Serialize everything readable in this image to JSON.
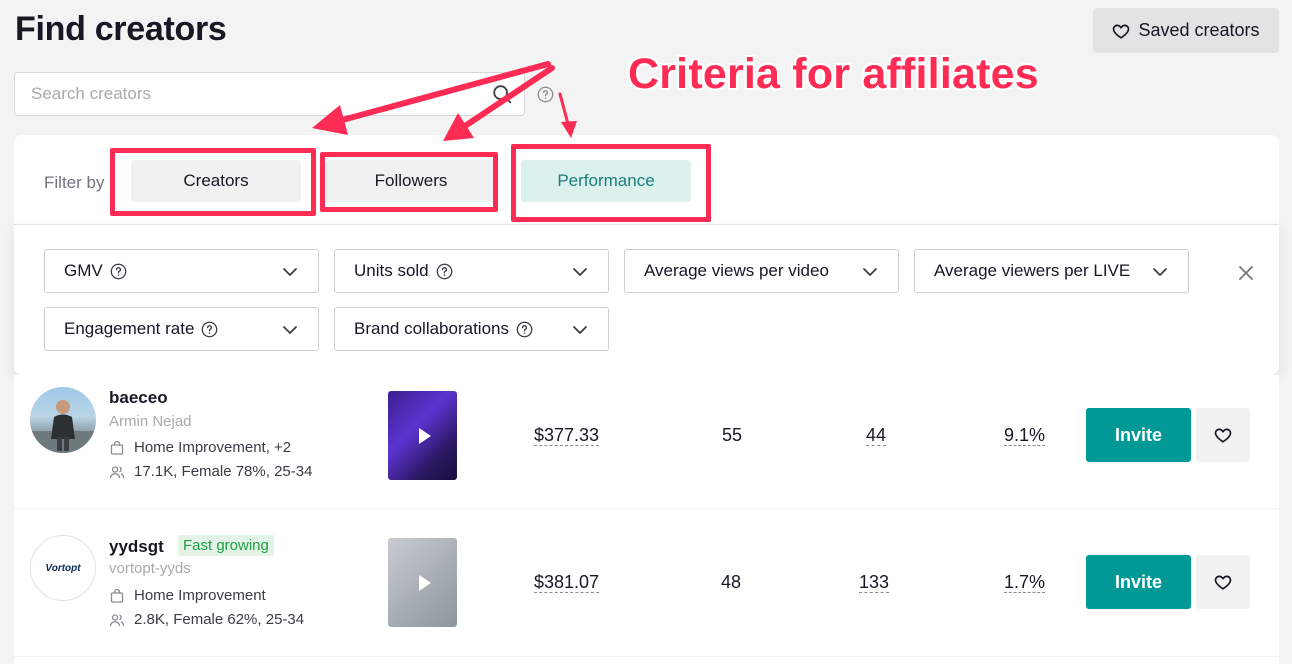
{
  "header": {
    "title": "Find creators",
    "saved_label": "Saved creators"
  },
  "search": {
    "placeholder": "Search creators"
  },
  "annotation": {
    "text": "Criteria for affiliates"
  },
  "filter": {
    "label": "Filter by",
    "tabs": [
      {
        "label": "Creators",
        "active": false
      },
      {
        "label": "Followers",
        "active": false
      },
      {
        "label": "Performance",
        "active": true
      }
    ]
  },
  "dropdowns": [
    {
      "label": "GMV",
      "has_help": true
    },
    {
      "label": "Units sold",
      "has_help": true
    },
    {
      "label": "Average views per video",
      "has_help": false
    },
    {
      "label": "Average viewers per LIVE",
      "has_help": false
    },
    {
      "label": "Engagement rate",
      "has_help": true
    },
    {
      "label": "Brand collaborations",
      "has_help": true
    }
  ],
  "creators": [
    {
      "handle": "baeceo",
      "name": "Armin Nejad",
      "badge": "",
      "category": "Home Improvement, +2",
      "audience": "17.1K, Female 78%, 25-34",
      "gmv": "$377.33",
      "units": "55",
      "views": "44",
      "engagement": "9.1%",
      "invite_label": "Invite"
    },
    {
      "handle": "yydsgt",
      "name": "vortopt-yyds",
      "badge": "Fast growing",
      "logo_text": "Vortopt",
      "category": "Home Improvement",
      "audience": "2.8K, Female 62%, 25-34",
      "gmv": "$381.07",
      "units": "48",
      "views": "133",
      "engagement": "1.7%",
      "invite_label": "Invite"
    }
  ],
  "colors": {
    "accent": "#009995",
    "annotation": "#fe2c55",
    "active_tab_bg": "#dcf0ee",
    "badge_text": "#1e9e45"
  }
}
